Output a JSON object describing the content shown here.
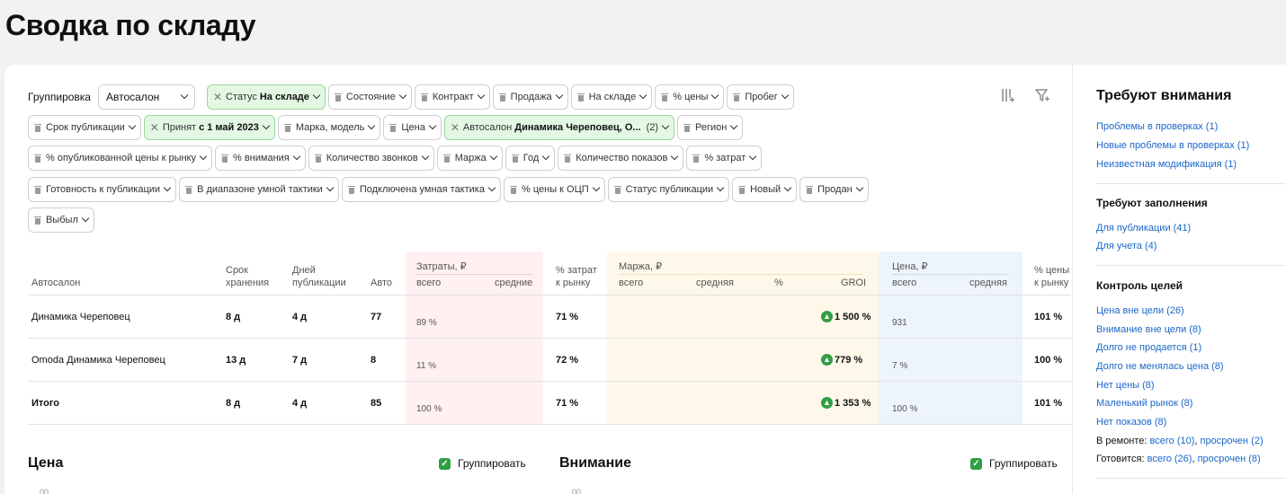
{
  "page_title": "Сводка по складу",
  "grouping": {
    "label": "Группировка",
    "value": "Автосалон"
  },
  "filters": {
    "row1": [
      {
        "label": "Статус",
        "value": "На складе",
        "active": true
      },
      {
        "label": "Состояние"
      },
      {
        "label": "Контракт"
      },
      {
        "label": "Продажа"
      },
      {
        "label": "На складе"
      },
      {
        "label": "% цены"
      },
      {
        "label": "Пробег"
      }
    ],
    "row2": [
      {
        "label": "Срок публикации"
      },
      {
        "label": "Принят",
        "value": "с 1 май 2023",
        "active": true
      },
      {
        "label": "Марка, модель"
      },
      {
        "label": "Цена"
      },
      {
        "label": "Автосалон",
        "value": "Динамика Череповец, О...",
        "count": "(2)",
        "active": true
      },
      {
        "label": "Регион"
      }
    ],
    "row3": [
      {
        "label": "% опубликованной цены к рынку"
      },
      {
        "label": "% внимания"
      },
      {
        "label": "Количество звонков"
      },
      {
        "label": "Маржа"
      },
      {
        "label": "Год"
      },
      {
        "label": "Количество показов"
      },
      {
        "label": "% затрат"
      }
    ],
    "row4": [
      {
        "label": "Готовность к публикации"
      },
      {
        "label": "В диапазоне умной тактики"
      },
      {
        "label": "Подключена умная тактика"
      },
      {
        "label": "% цены к ОЦП"
      },
      {
        "label": "Статус публикации"
      },
      {
        "label": "Новый"
      },
      {
        "label": "Продан"
      }
    ],
    "row5": [
      {
        "label": "Выбыл"
      }
    ]
  },
  "table": {
    "headers": {
      "dealer": "Автосалон",
      "storage": "Срок хранения",
      "days_pub": "Дней публикации",
      "cars": "Авто",
      "costs": "Затраты, ₽",
      "costs_total": "всего",
      "costs_avg": "средние",
      "costs_pct": "% затрат к рынку",
      "margin": "Маржа, ₽",
      "margin_total": "всего",
      "margin_avg": "средняя",
      "margin_pct": "%",
      "groi": "GROI",
      "price": "Цена, ₽",
      "price_total": "всего",
      "price_avg": "средняя",
      "price_pct": "% цены к рынку"
    },
    "rows": [
      {
        "dealer": "Динамика Череповец",
        "storage": "8 д",
        "days_pub": "4 д",
        "cars": "77",
        "costs_share": "89 %",
        "costs_pct": "71 %",
        "groi": "1 500 %",
        "price_share": "931",
        "price_pct": "101 %"
      },
      {
        "dealer": "Omoda Динамика Череповец",
        "storage": "13 д",
        "days_pub": "7 д",
        "cars": "8",
        "costs_share": "11 %",
        "costs_pct": "72 %",
        "groi": "779 %",
        "price_share": "7 %",
        "price_pct": "100 %"
      },
      {
        "dealer": "Итого",
        "storage": "8 д",
        "days_pub": "4 д",
        "cars": "85",
        "costs_share": "100 %",
        "costs_pct": "71 %",
        "groi": "1 353 %",
        "price_share": "100 %",
        "price_pct": "101 %"
      }
    ]
  },
  "bottom": {
    "price_title": "Цена",
    "attention_title": "Внимание",
    "group_label": "Группировать",
    "axis_tick": "00"
  },
  "sidebar": {
    "attention_title": "Требуют внимания",
    "attention_links": [
      "Проблемы в проверках (1)",
      "Новые проблемы в проверках (1)",
      "Неизвестная модификация (1)"
    ],
    "fill_title": "Требуют заполнения",
    "fill_links": [
      "Для публикации (41)",
      "Для учета (4)"
    ],
    "goals_title": "Контроль целей",
    "goals_links": [
      "Цена вне цели (26)",
      "Внимание вне цели (8)",
      "Долго не продается (1)",
      "Долго не менялась цена (8)",
      "Нет цены (8)",
      "Маленький рынок (8)",
      "Нет показов (8)"
    ],
    "repair": {
      "label": "В ремонте:",
      "all": "всего (10)",
      "sep": ",",
      "overdue": "просрочен (2)"
    },
    "preparing": {
      "label": "Готовится:",
      "all": "всего (26)",
      "sep": ",",
      "overdue": "просрочен (8)"
    }
  },
  "colors": {
    "costs_band": "#fff0f1",
    "margin_band": "#fdf8e9",
    "price_band": "#eef4fc",
    "active_chip": "#e3f7e3",
    "link": "#1a67c9",
    "green": "#2f9e44"
  }
}
